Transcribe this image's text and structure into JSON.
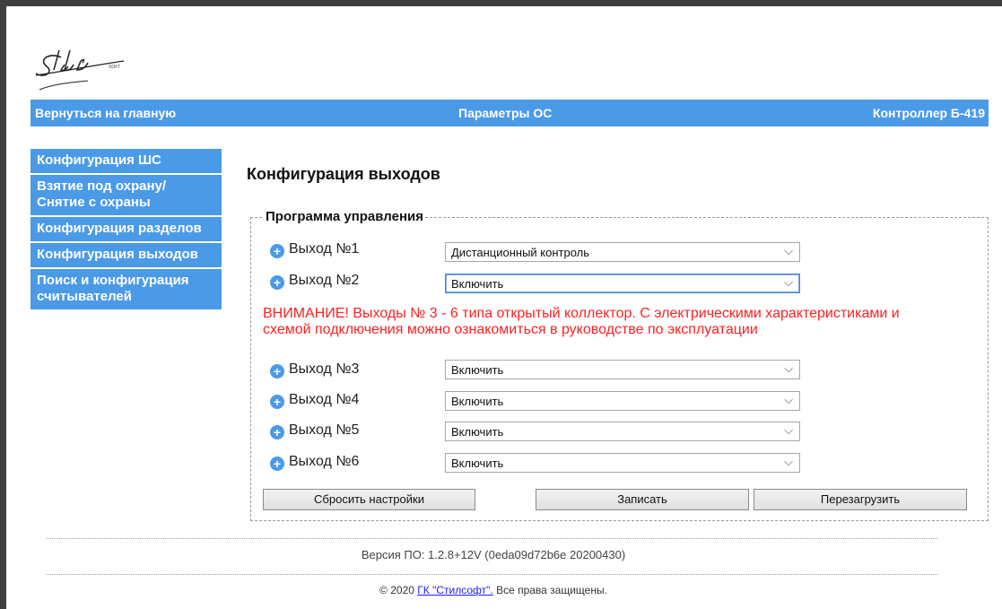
{
  "logo": {
    "text": "SOFT"
  },
  "topbar": {
    "back_link": "Вернуться на главную",
    "title": "Параметры ОС",
    "device": "Контроллер Б-419"
  },
  "sidebar": {
    "items": [
      {
        "label": "Конфигурация ШС"
      },
      {
        "label": "Взятие под охрану/ Снятие с охраны"
      },
      {
        "label": "Конфигурация разделов"
      },
      {
        "label": "Конфигурация выходов"
      },
      {
        "label": "Поиск и конфигурация считывателей"
      }
    ]
  },
  "main": {
    "title": "Конфигурация выходов",
    "legend": "Программа управления",
    "outputs": [
      {
        "label": "Выход №1",
        "value": "Дистанционный контроль"
      },
      {
        "label": "Выход №2",
        "value": "Включить"
      },
      {
        "label": "Выход №3",
        "value": "Включить"
      },
      {
        "label": "Выход №4",
        "value": "Включить"
      },
      {
        "label": "Выход №5",
        "value": "Включить"
      },
      {
        "label": "Выход №6",
        "value": "Включить"
      }
    ],
    "warning": "ВНИМАНИЕ! Выходы № 3 - 6 типа открытый коллектор. С электрическими характеристиками и схемой подключения можно ознакомиться в руководстве по эксплуатации",
    "buttons": {
      "reset": "Сбросить настройки",
      "write": "Записать",
      "reboot": "Перезагрузить"
    }
  },
  "footer": {
    "version": "Версия ПО: 1.2.8+12V (0eda09d72b6e 20200430)",
    "copyright_prefix": "© 2020 ",
    "company_link": "ГК \"Стилсофт\".",
    "copyright_suffix": " Все права защищены."
  },
  "colors": {
    "accent": "#4b9ae8",
    "warning": "#ff2020"
  }
}
